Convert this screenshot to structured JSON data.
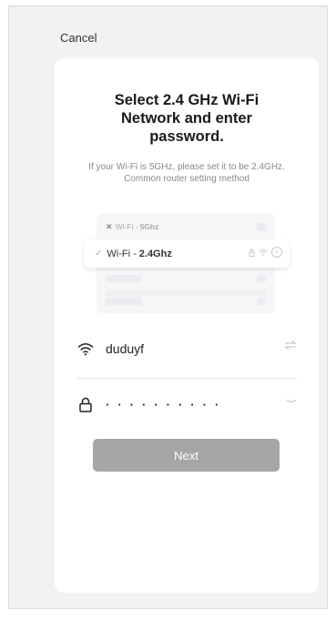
{
  "header": {
    "cancel_label": "Cancel"
  },
  "card": {
    "title": "Select 2.4 GHz Wi-Fi Network and enter password.",
    "subtitle": "If your Wi-Fi is 5GHz, please set it to be 2.4GHz. Common router setting method"
  },
  "illustration": {
    "row_5g": {
      "prefix": "Wi-Fi - ",
      "band": "5Ghz",
      "icon": "x-icon"
    },
    "row_24": {
      "prefix": "Wi-Fi - ",
      "band": "2.4Ghz",
      "icon": "check-icon"
    }
  },
  "wifi": {
    "ssid": "duduyf",
    "password_masked": "··········",
    "icons": {
      "ssid": "wifi-icon",
      "password": "lock-icon",
      "switch": "swap-icon",
      "visibility": "eye-closed-icon"
    }
  },
  "actions": {
    "next_label": "Next"
  },
  "colors": {
    "button_disabled": "#a6a6a6",
    "background": "#f2f2f2",
    "card": "#ffffff"
  }
}
